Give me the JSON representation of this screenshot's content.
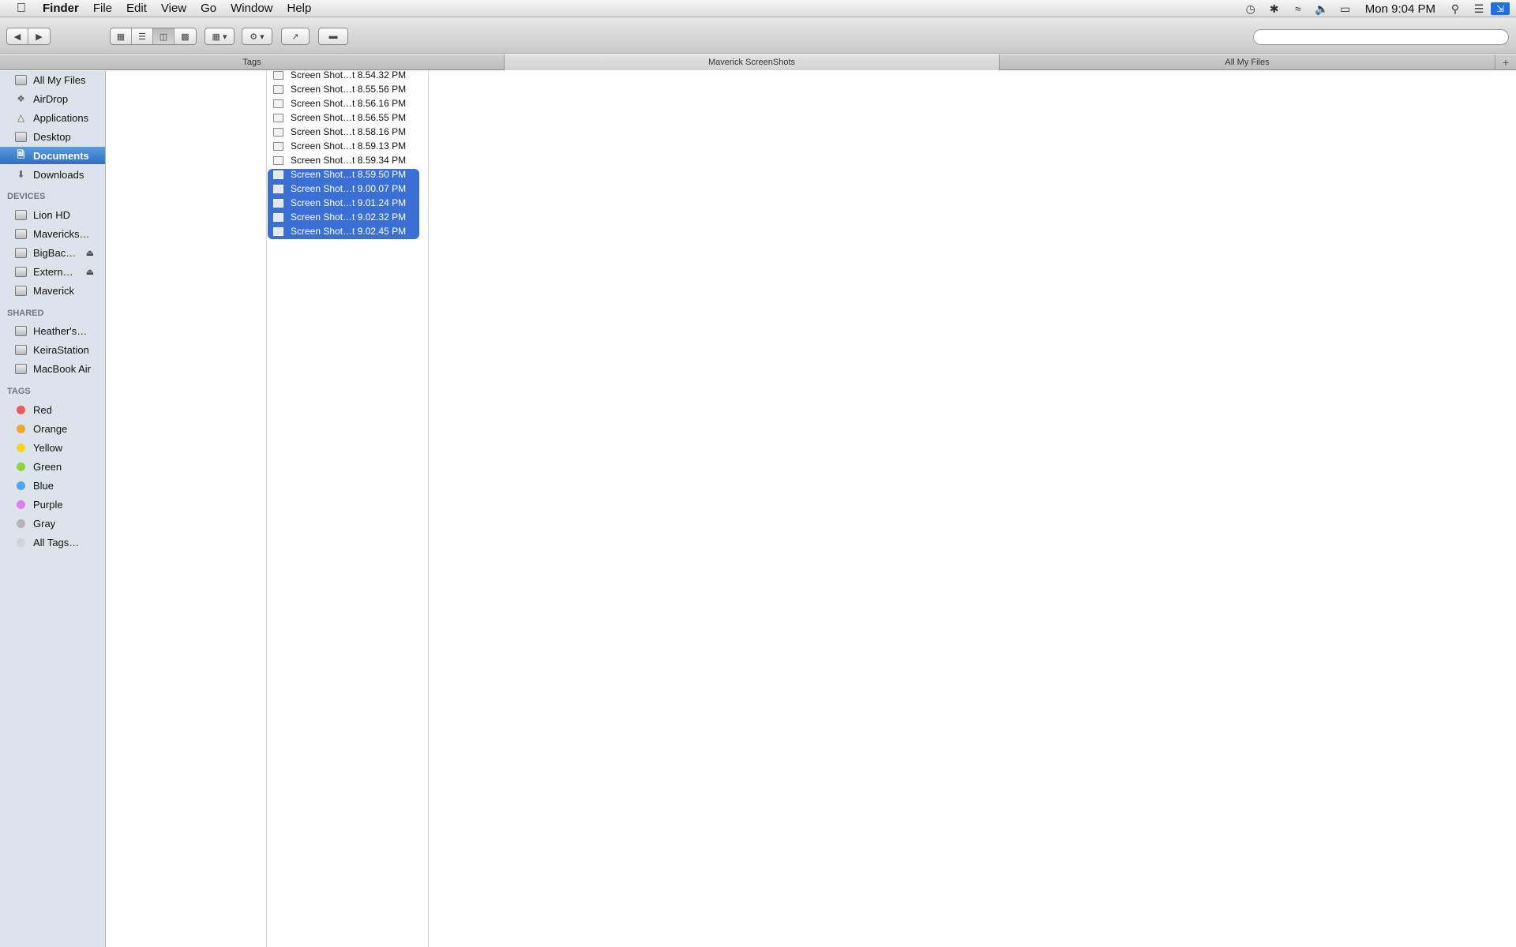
{
  "menubar": {
    "app_name": "Finder",
    "items": [
      "File",
      "Edit",
      "View",
      "Go",
      "Window",
      "Help"
    ],
    "clock": "Mon 9:04 PM",
    "status_icons": [
      "time-machine-icon",
      "bluetooth-icon",
      "wifi-icon",
      "volume-icon",
      "battery-icon",
      "spotlight-icon",
      "notification-center-icon",
      "fullscreen-icon"
    ]
  },
  "toolbar": {
    "search_placeholder": ""
  },
  "tabs": [
    "Tags",
    "Maverick ScreenShots",
    "All My Files"
  ],
  "sidebar": {
    "favorites": [
      "All My Files",
      "AirDrop",
      "Applications",
      "Desktop",
      "Documents",
      "Downloads"
    ],
    "selected": "Documents",
    "devices_heading": "DEVICES",
    "devices": [
      "Lion HD",
      "Mavericks…",
      "BigBac…",
      "Extern…",
      "Maverick"
    ],
    "shared_heading": "SHARED",
    "shared": [
      "Heather's…",
      "KeiraStation",
      "MacBook Air"
    ],
    "tags_heading": "TAGS",
    "tags": [
      {
        "label": "Red",
        "color": "#f0595a"
      },
      {
        "label": "Orange",
        "color": "#f5a623"
      },
      {
        "label": "Yellow",
        "color": "#f2d81c"
      },
      {
        "label": "Green",
        "color": "#8cd43a"
      },
      {
        "label": "Blue",
        "color": "#4ea7f0"
      },
      {
        "label": "Purple",
        "color": "#e27ee8"
      },
      {
        "label": "Gray",
        "color": "#b5b5b5"
      },
      {
        "label": "All Tags…",
        "color": "#d0d4d9"
      }
    ]
  },
  "files": [
    {
      "name": "Screen Shot…t 8.54.32 PM",
      "selected": false
    },
    {
      "name": "Screen Shot…t 8.55.56 PM",
      "selected": false
    },
    {
      "name": "Screen Shot…t 8.56.16 PM",
      "selected": false
    },
    {
      "name": "Screen Shot…t 8.56.55 PM",
      "selected": false
    },
    {
      "name": "Screen Shot…t 8.58.16 PM",
      "selected": false
    },
    {
      "name": "Screen Shot…t 8.59.13 PM",
      "selected": false
    },
    {
      "name": "Screen Shot…t 8.59.34 PM",
      "selected": false
    },
    {
      "name": "Screen Shot…t 8.59.50 PM",
      "selected": true
    },
    {
      "name": "Screen Shot…t 9.00.07 PM",
      "selected": true
    },
    {
      "name": "Screen Shot…t 9.01.24 PM",
      "selected": true
    },
    {
      "name": "Screen Shot…t 9.02.32 PM",
      "selected": true
    },
    {
      "name": "Screen Shot…t 9.02.45 PM",
      "selected": true
    }
  ]
}
